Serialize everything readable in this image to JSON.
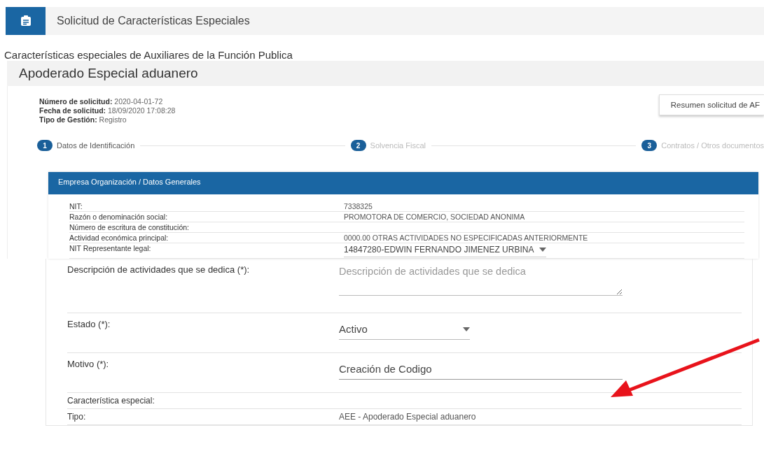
{
  "header": {
    "title": "Solicitud de Características Especiales"
  },
  "subtitle": "Características especiales de Auxiliares de la Función Publica",
  "panel": {
    "title": "Apoderado Especial aduanero",
    "info": [
      "**Número de solicitud:** 2020-04-01-72",
      "**Fecha de solicitud:** 18/09/2020 17:08:28",
      "**Tipo de Gestión:** Registro"
    ],
    "summary_button": "Resumen solicitud de AF",
    "steps": [
      {
        "number": "1",
        "label": "Datos de Identificación",
        "active": true
      },
      {
        "number": "2",
        "label": "Solvencia Fiscal",
        "active": false
      },
      {
        "number": "3",
        "label": "Contratos / Otros documentos",
        "active": false
      }
    ],
    "section": {
      "title": "Empresa Organización / Datos Generales",
      "rows": [
        {
          "kind": "text",
          "label": "NIT:",
          "value": "7338325"
        },
        {
          "kind": "text",
          "label": "Razón o denominación social:",
          "value": "PROMOTORA DE COMERCIO, SOCIEDAD ANONIMA"
        },
        {
          "kind": "text",
          "label": "Número de escritura de constitución:"
        },
        {
          "kind": "text",
          "label": "Actividad económica principal:",
          "value": "0000.00 OTRAS ACTIVIDADES NO ESPECIFICADAS ANTERIORMENTE"
        },
        {
          "kind": "select",
          "label": "NIT Representante legal:",
          "value": "14847280-EDWIN FERNANDO JIMENEZ URBINA"
        }
      ]
    },
    "form": [
      {
        "kind": "textarea",
        "label": "Descripción de actividades que se dedica (*):",
        "placeholder": "Descripción de actividades que se dedica"
      },
      {
        "kind": "select",
        "label": "Estado (*):",
        "value": "Activo"
      },
      {
        "kind": "input",
        "label": "Motivo (*):",
        "value": "Creación de Codigo"
      },
      {
        "kind": "text",
        "label": "Característica especial:"
      },
      {
        "kind": "text",
        "label": "Tipo:",
        "value": "AEE - Apoderado Especial aduanero"
      }
    ]
  }
}
